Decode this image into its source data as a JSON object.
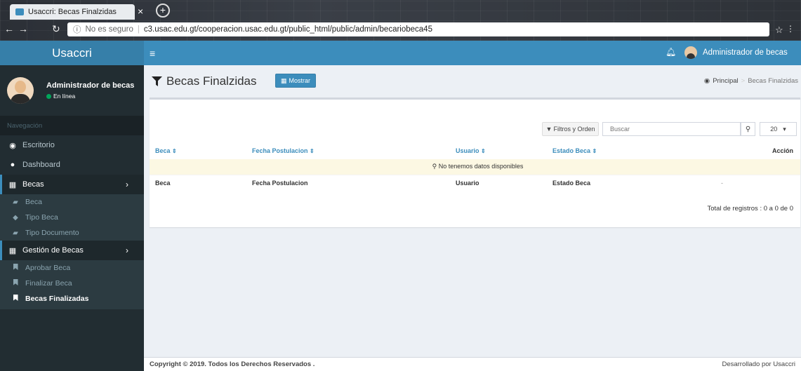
{
  "browser": {
    "tab_title": "Usaccri: Becas Finalzidas",
    "tab_close": "×",
    "new_tab": "+",
    "insecure_label": "No es seguro",
    "url": "c3.usac.edu.gt/cooperacion.usac.edu.gt/public_html/public/admin/becariobeca45"
  },
  "app": {
    "logo": "Usaccri",
    "accent_color": "#3c8dbc"
  },
  "topbar": {
    "user_name": "Administrador de becas"
  },
  "sidebar": {
    "user_name": "Administrador de becas",
    "status": "En línea",
    "nav_header": "Navegación",
    "items": [
      {
        "label": "Escritorio",
        "icon": "dashboard-icon"
      },
      {
        "label": "Dashboard",
        "icon": "user-icon"
      },
      {
        "label": "Becas",
        "icon": "table-icon"
      },
      {
        "label": "Gestión de Becas",
        "icon": "table-icon"
      }
    ],
    "becas_sub": [
      {
        "label": "Beca",
        "icon": "book-icon"
      },
      {
        "label": "Tipo Beca",
        "icon": "graduation-cap-icon"
      },
      {
        "label": "Tipo Documento",
        "icon": "book-icon"
      }
    ],
    "gestion_sub": [
      {
        "label": "Aprobar Beca",
        "icon": "bookmark-icon"
      },
      {
        "label": "Finalizar Beca",
        "icon": "bookmark-icon"
      },
      {
        "label": "Becas Finalizadas",
        "icon": "bookmark-icon"
      }
    ]
  },
  "content": {
    "title": "Becas Finalzidas",
    "show_button": "Mostrar",
    "breadcrumb": {
      "home": "Principal",
      "current": "Becas Finalzidas"
    }
  },
  "table": {
    "filters_button": "Filtros y Orden",
    "search_placeholder": "Buscar",
    "page_size": "20",
    "headers": [
      "Beca",
      "Fecha Postulacion",
      "Usuario",
      "Estado Beca",
      "Acción"
    ],
    "empty_message": "No tenemos datos disponibles",
    "footer_row": [
      "Beca",
      "Fecha Postulacion",
      "Usuario",
      "Estado Beca",
      "-"
    ],
    "total": "Total de registros : 0 a 0 de 0"
  },
  "footer": {
    "copyright": "Copyright © 2019. Todos los Derechos Reservados .",
    "developer": "Desarrollado por Usaccri"
  }
}
